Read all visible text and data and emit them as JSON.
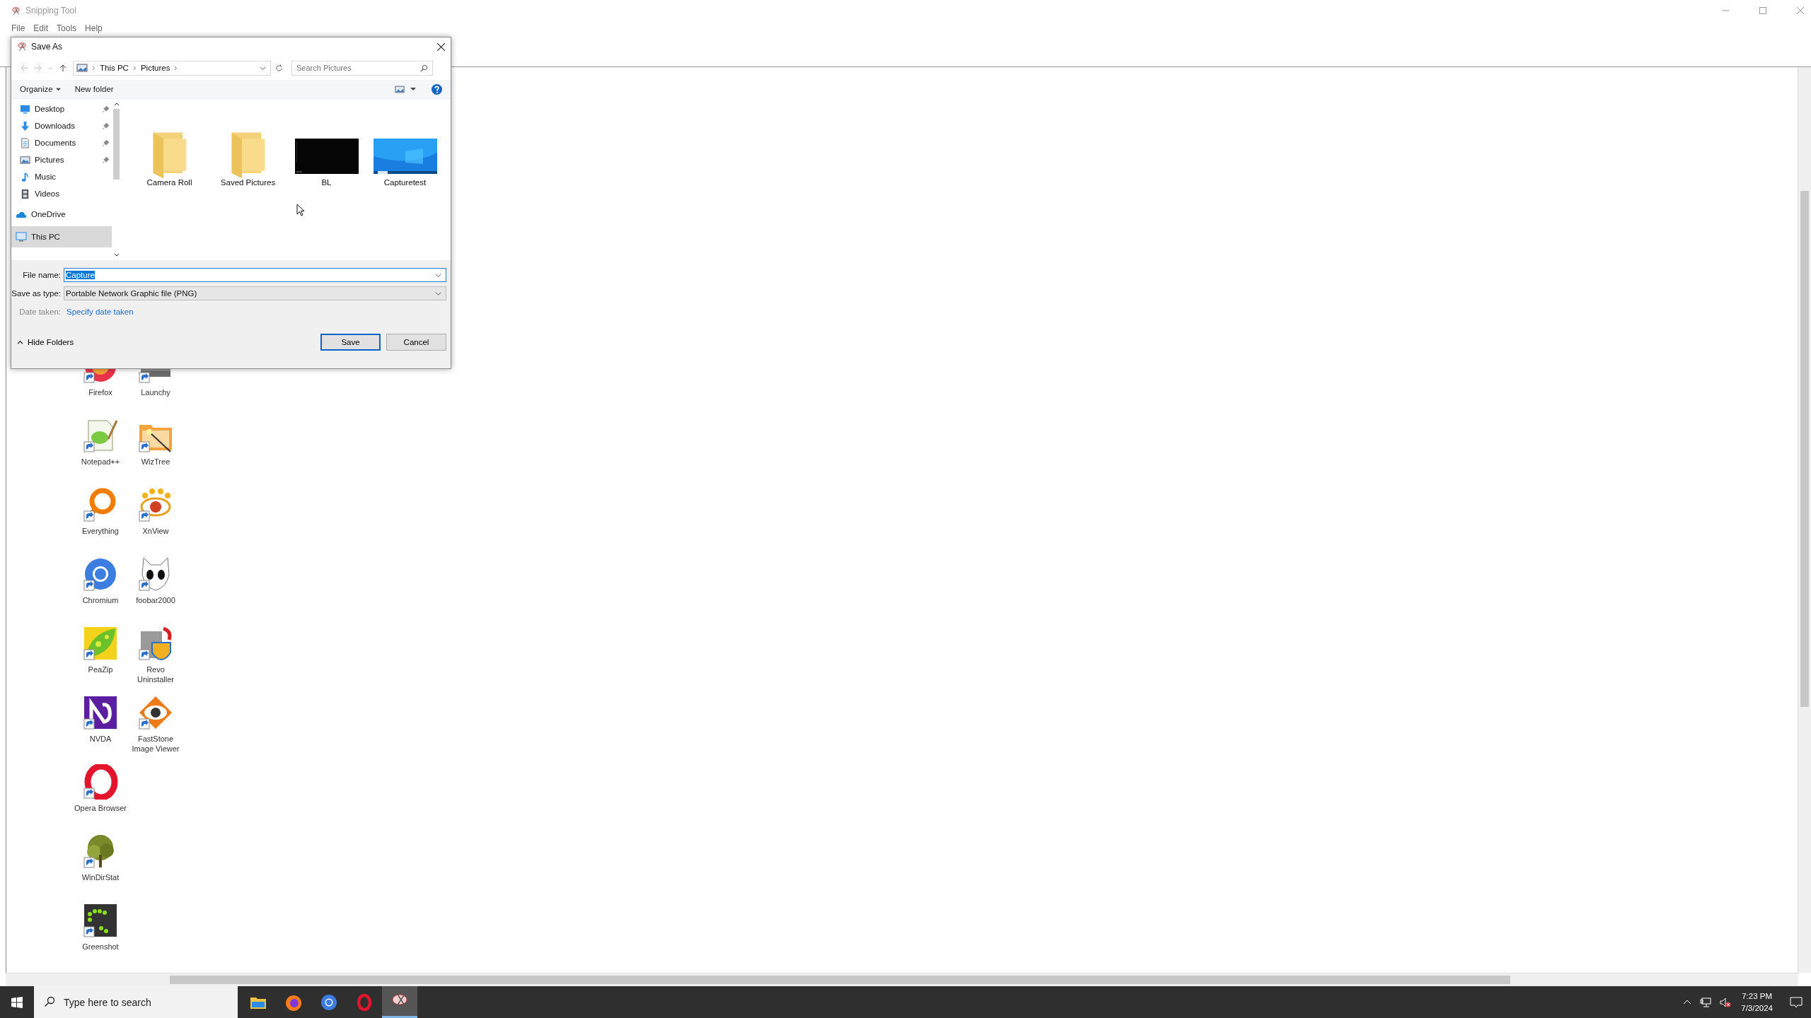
{
  "window": {
    "title": "Snipping Tool"
  },
  "menu": [
    "File",
    "Edit",
    "Tools",
    "Help"
  ],
  "capture": {
    "columns": [
      [
        {
          "label": "Firefox"
        },
        {
          "label": "Notepad++"
        },
        {
          "label": "Everything"
        },
        {
          "label": "Chromium"
        },
        {
          "label": "PeaZip"
        },
        {
          "label": "NVDA"
        },
        {
          "label": "Opera Browser"
        },
        {
          "label": "WinDirStat"
        },
        {
          "label": "Greenshot"
        }
      ],
      [
        {
          "label": "Launchy"
        },
        {
          "label": "WizTree"
        },
        {
          "label": "XnView"
        },
        {
          "label": "foobar2000"
        },
        {
          "label": "Revo Uninstaller"
        },
        {
          "label": "FastStone Image Viewer"
        }
      ]
    ]
  },
  "dialog": {
    "title": "Save As",
    "breadcrumb": [
      "This PC",
      "Pictures"
    ],
    "search": {
      "placeholder": "Search Pictures"
    },
    "toolbar": {
      "organize": "Organize",
      "new_folder": "New folder"
    },
    "quick_access": [
      {
        "label": "Desktop",
        "pinned": true
      },
      {
        "label": "Downloads",
        "pinned": true
      },
      {
        "label": "Documents",
        "pinned": true
      },
      {
        "label": "Pictures",
        "pinned": true
      },
      {
        "label": "Music",
        "pinned": false
      },
      {
        "label": "Videos",
        "pinned": false
      }
    ],
    "roots": [
      {
        "label": "OneDrive",
        "selected": false
      },
      {
        "label": "This PC",
        "selected": true
      }
    ],
    "items": [
      {
        "label": "Camera Roll",
        "kind": "folder"
      },
      {
        "label": "Saved Pictures",
        "kind": "folder"
      },
      {
        "label": "BL",
        "kind": "picture"
      },
      {
        "label": "Capturetest",
        "kind": "picture"
      }
    ],
    "file_name": {
      "label": "File name:",
      "value": "Capture",
      "text_selected": true
    },
    "save_as_type": {
      "label": "Save as type:",
      "value": "Portable Network Graphic file (PNG)"
    },
    "date_taken": {
      "label": "Date taken:",
      "link": "Specify date taken"
    },
    "hide_folders": "Hide Folders",
    "buttons": [
      {
        "label": "Save",
        "default": true
      },
      {
        "label": "Cancel",
        "default": false
      }
    ]
  },
  "taskbar": {
    "search": {
      "placeholder": "Type here to search"
    },
    "apps": [
      {
        "selected": false
      },
      {
        "selected": false
      },
      {
        "selected": false
      },
      {
        "selected": false
      },
      {
        "selected": true
      }
    ],
    "time": "7:23 PM",
    "date": "7/3/2024"
  }
}
